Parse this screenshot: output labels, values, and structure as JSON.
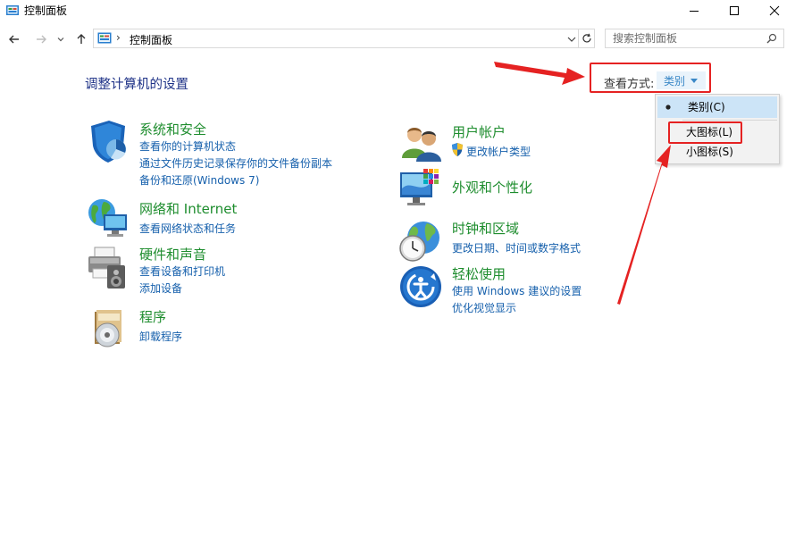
{
  "window": {
    "title": "控制面板"
  },
  "navigation": {
    "breadcrumb_sep": "›",
    "address_path": "控制面板",
    "search_placeholder": "搜索控制面板"
  },
  "main": {
    "page_title": "调整计算机的设置",
    "view_by": {
      "label": "查看方式:",
      "selected": "类别",
      "options": [
        "类别(C)",
        "大图标(L)",
        "小图标(S)"
      ]
    },
    "categories_left": [
      {
        "title": "系统和安全",
        "links": [
          "查看你的计算机状态",
          "通过文件历史记录保存你的文件备份副本",
          "备份和还原(Windows 7)"
        ]
      },
      {
        "title": "网络和 Internet",
        "links": [
          "查看网络状态和任务"
        ]
      },
      {
        "title": "硬件和声音",
        "links": [
          "查看设备和打印机",
          "添加设备"
        ]
      },
      {
        "title": "程序",
        "links": [
          "卸载程序"
        ]
      }
    ],
    "categories_right": [
      {
        "title": "用户帐户",
        "links": [
          "更改帐户类型"
        ]
      },
      {
        "title": "外观和个性化",
        "links": []
      },
      {
        "title": "时钟和区域",
        "links": [
          "更改日期、时间或数字格式"
        ]
      },
      {
        "title": "轻松使用",
        "links": [
          "使用 Windows 建议的设置",
          "优化视觉显示"
        ]
      }
    ]
  },
  "colors": {
    "category_title": "#1e8d2e",
    "link": "#1660ac",
    "page_title": "#1e3287",
    "annotation": "#e52222"
  }
}
